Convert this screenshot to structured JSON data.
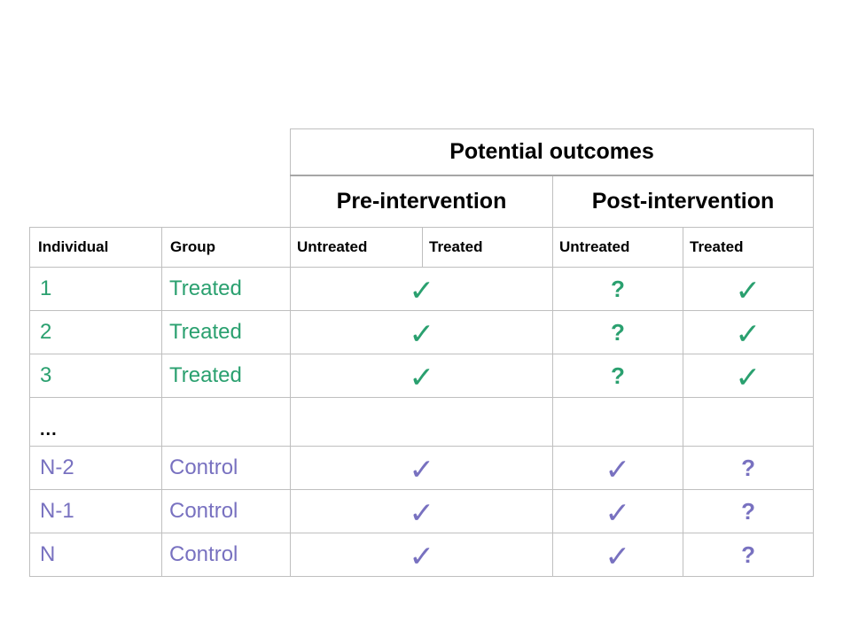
{
  "table": {
    "super_header": "Potential outcomes",
    "phase_headers": [
      "Pre-intervention",
      "Post-intervention"
    ],
    "column_headers": {
      "individual": "Individual",
      "group": "Group",
      "pre_untreated": "Untreated",
      "pre_treated": "Treated",
      "post_untreated": "Untreated",
      "post_treated": "Treated"
    },
    "symbols": {
      "check": "✓",
      "question": "?",
      "ellipsis": "..."
    },
    "colors": {
      "treated": "#2aa06f",
      "control": "#7871c0",
      "header_text": "#000000",
      "border": "#bfbfbf",
      "border_strong": "#a6a6a6",
      "background": "#ffffff"
    },
    "rows": [
      {
        "id": "1",
        "group": "Treated",
        "color_class": "treated",
        "pre": "✓",
        "post_untreated": "?",
        "post_treated": "✓"
      },
      {
        "id": "2",
        "group": "Treated",
        "color_class": "treated",
        "pre": "✓",
        "post_untreated": "?",
        "post_treated": "✓"
      },
      {
        "id": "3",
        "group": "Treated",
        "color_class": "treated",
        "pre": "✓",
        "post_untreated": "?",
        "post_treated": "✓"
      },
      {
        "id": "...",
        "group": "",
        "color_class": "neutral",
        "pre": "",
        "post_untreated": "",
        "post_treated": ""
      },
      {
        "id": "N-2",
        "group": "Control",
        "color_class": "control",
        "pre": "✓",
        "post_untreated": "✓",
        "post_treated": "?"
      },
      {
        "id": "N-1",
        "group": "Control",
        "color_class": "control",
        "pre": "✓",
        "post_untreated": "✓",
        "post_treated": "?"
      },
      {
        "id": "N",
        "group": "Control",
        "color_class": "control",
        "pre": "✓",
        "post_untreated": "✓",
        "post_treated": "?"
      }
    ]
  }
}
